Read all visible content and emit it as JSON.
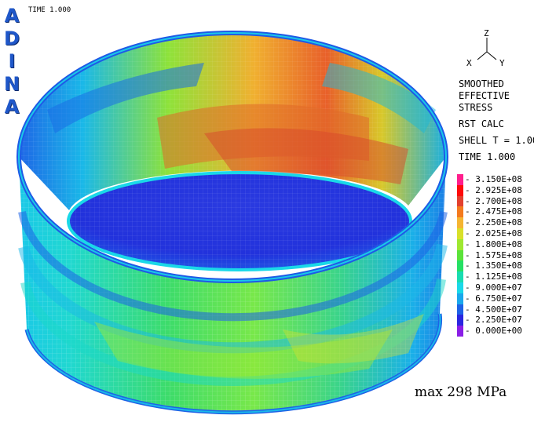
{
  "brand": {
    "letters": [
      "A",
      "D",
      "I",
      "N",
      "A"
    ]
  },
  "header": {
    "time_label": "TIME 1.000"
  },
  "axes": {
    "z": "Z",
    "x": "X",
    "y": "Y"
  },
  "info": {
    "lines": [
      "SMOOTHED",
      "EFFECTIVE",
      "STRESS"
    ],
    "calc": "RST CALC",
    "shell": "SHELL T = 1.00",
    "time": "TIME 1.000"
  },
  "legend": {
    "entries": [
      {
        "label": "3.150E+08",
        "color": "#ff1e8c"
      },
      {
        "label": "2.925E+08",
        "color": "#ff0a0a"
      },
      {
        "label": "2.700E+08",
        "color": "#e3402e"
      },
      {
        "label": "2.475E+08",
        "color": "#f47a1e"
      },
      {
        "label": "2.250E+08",
        "color": "#f5b532"
      },
      {
        "label": "2.025E+08",
        "color": "#d8e02a"
      },
      {
        "label": "1.800E+08",
        "color": "#9ee830"
      },
      {
        "label": "1.575E+08",
        "color": "#5be33a"
      },
      {
        "label": "1.350E+08",
        "color": "#25e064"
      },
      {
        "label": "1.125E+08",
        "color": "#18dcb0"
      },
      {
        "label": "9.000E+07",
        "color": "#1ad8e8"
      },
      {
        "label": "6.750E+07",
        "color": "#1aa8ec"
      },
      {
        "label": "4.500E+07",
        "color": "#1e62e6"
      },
      {
        "label": "2.250E+07",
        "color": "#2a26e0"
      },
      {
        "label": "0.000E+00",
        "color": "#8a1ee6"
      }
    ]
  },
  "footer": {
    "max_label": "max 298 MPa"
  }
}
